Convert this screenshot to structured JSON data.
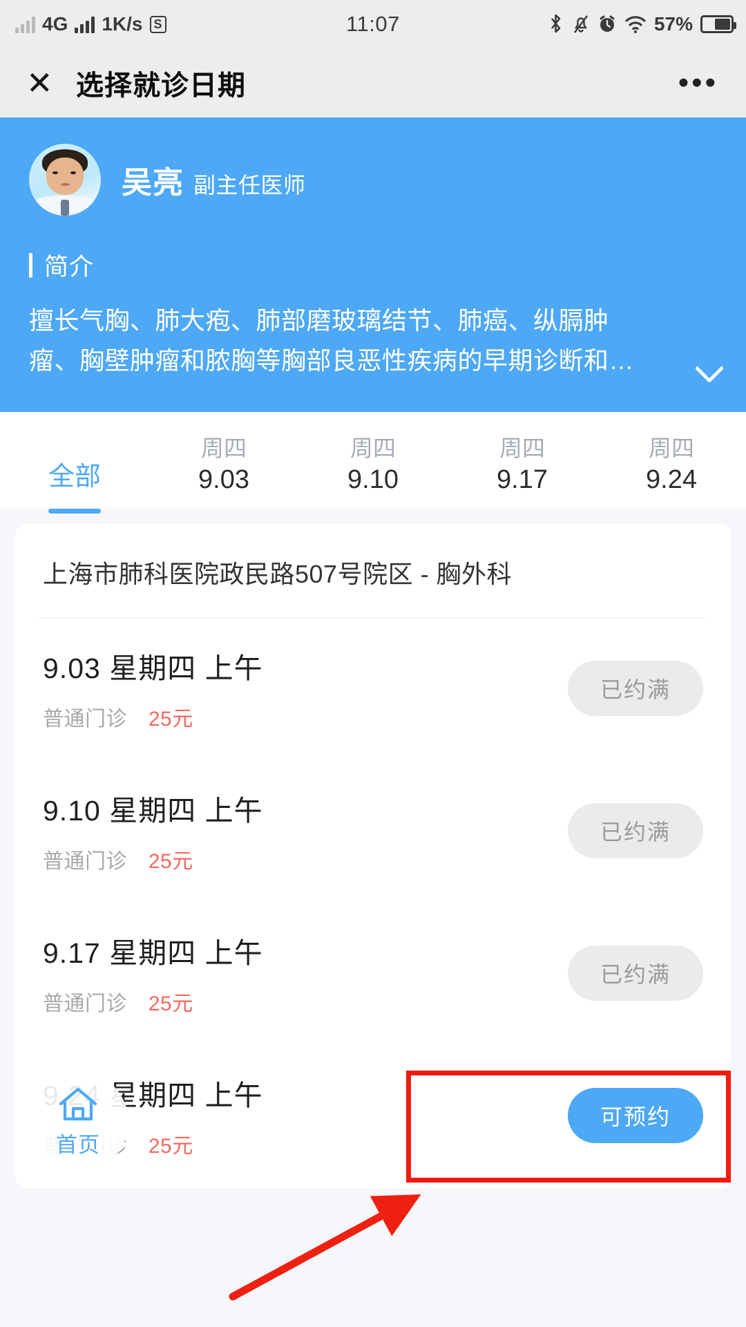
{
  "status_bar": {
    "network_type": "4G",
    "data_rate": "1K/s",
    "app_badge": "S",
    "time": "11:07",
    "battery_percent": "57%",
    "icons": [
      "signal-bars-icon",
      "signal-bars-icon",
      "s-box-icon",
      "bluetooth-icon",
      "mute-bell-icon",
      "alarm-clock-icon",
      "wifi-icon",
      "battery-icon"
    ]
  },
  "nav": {
    "close_label": "✕",
    "title": "选择就诊日期",
    "more_label": "•••"
  },
  "doctor": {
    "name": "吴亮",
    "title": "副主任医师",
    "intro_label": "简介",
    "intro_line1": "擅长气胸、肺大疱、肺部磨玻璃结节、肺癌、纵膈肿",
    "intro_line2": "瘤、胸壁肿瘤和脓胸等胸部良恶性疾病的早期诊断和…",
    "expand_icon": "chevron-down-icon",
    "banner_color": "#4da8f5"
  },
  "date_tabs": [
    {
      "weekday": "",
      "date": "全部",
      "active": true
    },
    {
      "weekday": "周四",
      "date": "9.03",
      "active": false
    },
    {
      "weekday": "周四",
      "date": "9.10",
      "active": false
    },
    {
      "weekday": "周四",
      "date": "9.17",
      "active": false
    },
    {
      "weekday": "周四",
      "date": "9.24",
      "active": false
    }
  ],
  "schedule": {
    "hospital": "上海市肺科医院政民路507号院区 - 胸外科",
    "slots": [
      {
        "date": "9.03",
        "weekday": "星期四",
        "period": "上午",
        "clinic_type": "普通门诊",
        "price": "25元",
        "status_label": "已约满",
        "available": false
      },
      {
        "date": "9.10",
        "weekday": "星期四",
        "period": "上午",
        "clinic_type": "普通门诊",
        "price": "25元",
        "status_label": "已约满",
        "available": false
      },
      {
        "date": "9.17",
        "weekday": "星期四",
        "period": "上午",
        "clinic_type": "普通门诊",
        "price": "25元",
        "status_label": "已约满",
        "available": false
      },
      {
        "date": "9.24",
        "weekday": "星期四",
        "period": "上午",
        "clinic_type": "普通门诊",
        "price": "25元",
        "status_label": "可预约",
        "available": true
      }
    ]
  },
  "home_fab": {
    "label": "首页",
    "icon": "home-icon"
  },
  "annotation": {
    "highlight_color": "#f01b10",
    "arrow_color": "#ee2012"
  },
  "colors": {
    "accent": "#4da8f5",
    "price": "#f4695f",
    "disabled_bg": "#ebebeb",
    "disabled_text": "#9a9a9a"
  }
}
